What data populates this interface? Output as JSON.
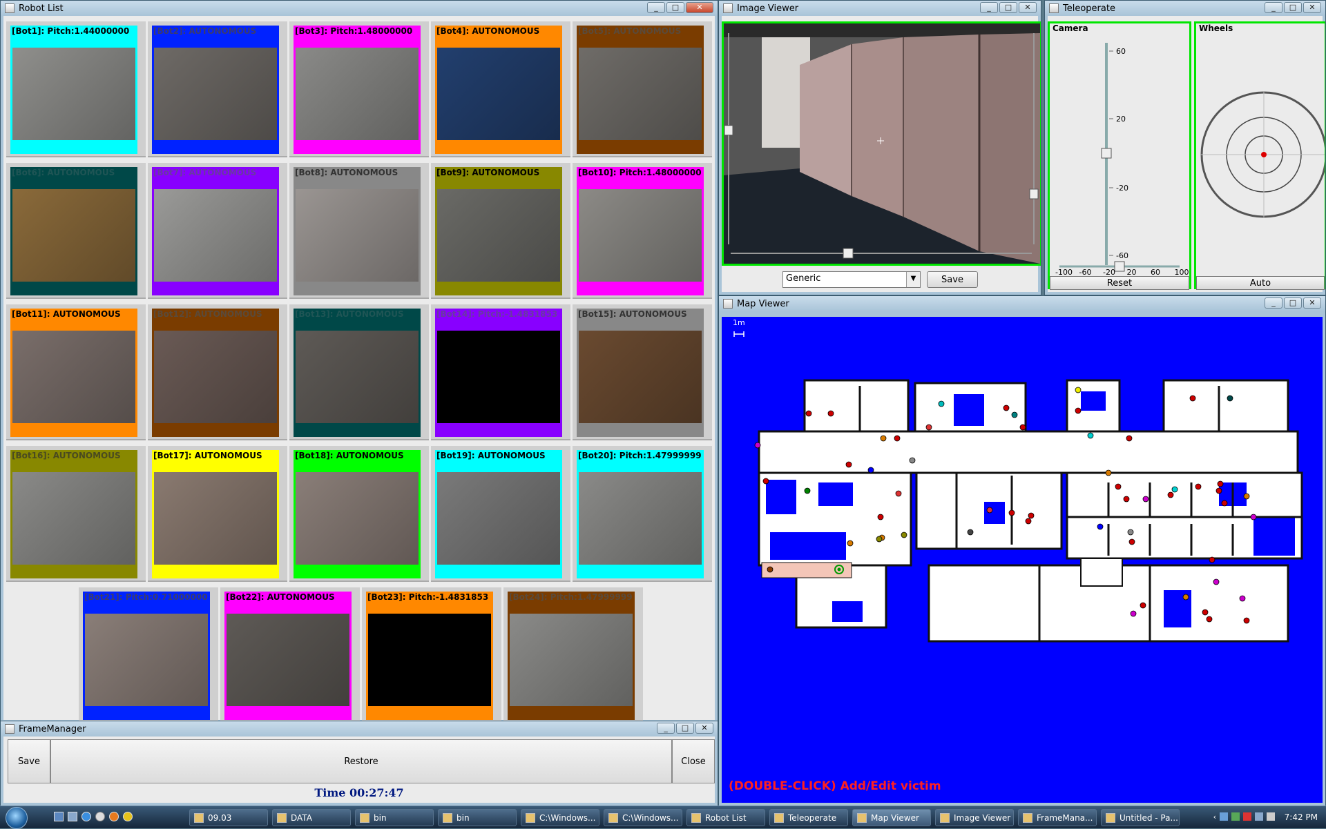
{
  "robot_list": {
    "title": "Robot List",
    "bots": [
      {
        "label": "[Bot1]: Pitch:1.44000000",
        "color": "#00ffff",
        "text_color": "#000000",
        "img": "#8f8f8c"
      },
      {
        "label": "[Bot2]: AUTONOMOUS",
        "color": "#0022ff",
        "text_color": "#3b3b6e",
        "img": "#6e6a66"
      },
      {
        "label": "[Bot3]: Pitch:1.48000000",
        "color": "#ff00ff",
        "text_color": "#000000",
        "img": "#8a8a88"
      },
      {
        "label": "[Bot4]: AUTONOMOUS",
        "color": "#ff8800",
        "text_color": "#000000",
        "img": "#223f6e"
      },
      {
        "label": "[Bot5]: AUTONOMOUS",
        "color": "#7a3c00",
        "text_color": "#5a4a3a",
        "img": "#6f6c68"
      },
      {
        "label": "[Bot6]: AUTONOMOUS",
        "color": "#004848",
        "text_color": "#1f5555",
        "img": "#8a6a3a"
      },
      {
        "label": "[Bot7]: AUTONOMOUS",
        "color": "#8800ff",
        "text_color": "#6a3aa0",
        "img": "#9a9a98"
      },
      {
        "label": "[Bot8]: AUTONOMOUS",
        "color": "#888888",
        "text_color": "#333333",
        "img": "#9a9592"
      },
      {
        "label": "[Bot9]: AUTONOMOUS",
        "color": "#888800",
        "text_color": "#000000",
        "img": "#6a6a66"
      },
      {
        "label": "[Bot10]: Pitch:1.48000000",
        "color": "#ff00ff",
        "text_color": "#000000",
        "img": "#8c8a86"
      },
      {
        "label": "[Bot11]: AUTONOMOUS",
        "color": "#ff8800",
        "text_color": "#000000",
        "img": "#7a6e6a"
      },
      {
        "label": "[Bot12]: AUTONOMOUS",
        "color": "#7a3c00",
        "text_color": "#5a4a3a",
        "img": "#6a5a55"
      },
      {
        "label": "[Bot13]: AUTONOMOUS",
        "color": "#004848",
        "text_color": "#1f5555",
        "img": "#5e5a56"
      },
      {
        "label": "[Bot14]: Pitch:-1.4831853",
        "color": "#8800ff",
        "text_color": "#6a3aa0",
        "img": "#000000"
      },
      {
        "label": "[Bot15]: AUTONOMOUS",
        "color": "#888888",
        "text_color": "#333333",
        "img": "#6a4a30"
      },
      {
        "label": "[Bot16]: AUTONOMOUS",
        "color": "#888800",
        "text_color": "#4a4a20",
        "img": "#8a8a88"
      },
      {
        "label": "[Bot17]: AUTONOMOUS",
        "color": "#ffff00",
        "text_color": "#000000",
        "img": "#8a7a70"
      },
      {
        "label": "[Bot18]: AUTONOMOUS",
        "color": "#00ff00",
        "text_color": "#000000",
        "img": "#8a7e78"
      },
      {
        "label": "[Bot19]: AUTONOMOUS",
        "color": "#00ffff",
        "text_color": "#000000",
        "img": "#7a7a7a"
      },
      {
        "label": "[Bot20]: Pitch:1.47999999",
        "color": "#00ffff",
        "text_color": "#000000",
        "img": "#8a8a88"
      },
      {
        "label": "[Bot21]: Pitch:0.71000000",
        "color": "#0022ff",
        "text_color": "#3b3b6e",
        "img": "#8a7e78"
      },
      {
        "label": "[Bot22]: AUTONOMOUS",
        "color": "#ff00ff",
        "text_color": "#000000",
        "img": "#5e5a56"
      },
      {
        "label": "[Bot23]: Pitch:-1.4831853",
        "color": "#ff8800",
        "text_color": "#000000",
        "img": "#000000"
      },
      {
        "label": "[Bot24]: Pitch:1.47999999",
        "color": "#7a3c00",
        "text_color": "#5a4a3a",
        "img": "#8a8a88"
      }
    ]
  },
  "frame_manager": {
    "title": "FrameManager",
    "save_label": "Save",
    "restore_label": "Restore",
    "close_label": "Close",
    "time": "Time 00:27:47"
  },
  "image_viewer": {
    "title": "Image Viewer",
    "mode": "Generic",
    "save_label": "Save",
    "horizontal_slider": 0.39,
    "vertical_slider": 0.46
  },
  "teleoperate": {
    "title": "Teleoperate",
    "camera_label": "Camera",
    "wheels_label": "Wheels",
    "camera_ticks": [
      "60",
      "20",
      "-20",
      "-60"
    ],
    "camera_h_ticks": [
      "-100",
      "-60",
      "-20",
      "20",
      "60",
      "100"
    ],
    "camera_tilt": 0,
    "camera_pan": 0,
    "reset_label": "Reset",
    "auto_label": "Auto"
  },
  "map_viewer": {
    "title": "Map Viewer",
    "scale_label": "1m",
    "hint": "(DOUBLE-CLICK) Add/Edit victim"
  },
  "taskbar": {
    "items": [
      {
        "label": "09.03",
        "active": false
      },
      {
        "label": "DATA",
        "active": false
      },
      {
        "label": "bin",
        "active": false
      },
      {
        "label": "bin",
        "active": false
      },
      {
        "label": "C:\\Windows...",
        "active": false
      },
      {
        "label": "C:\\Windows...",
        "active": false
      },
      {
        "label": "Robot List",
        "active": false
      },
      {
        "label": "Teleoperate",
        "active": false
      },
      {
        "label": "Map Viewer",
        "active": true
      },
      {
        "label": "Image Viewer",
        "active": false
      },
      {
        "label": "FrameMana...",
        "active": false
      },
      {
        "label": "Untitled - Pa...",
        "active": false
      }
    ],
    "clock": "7:42 PM"
  }
}
